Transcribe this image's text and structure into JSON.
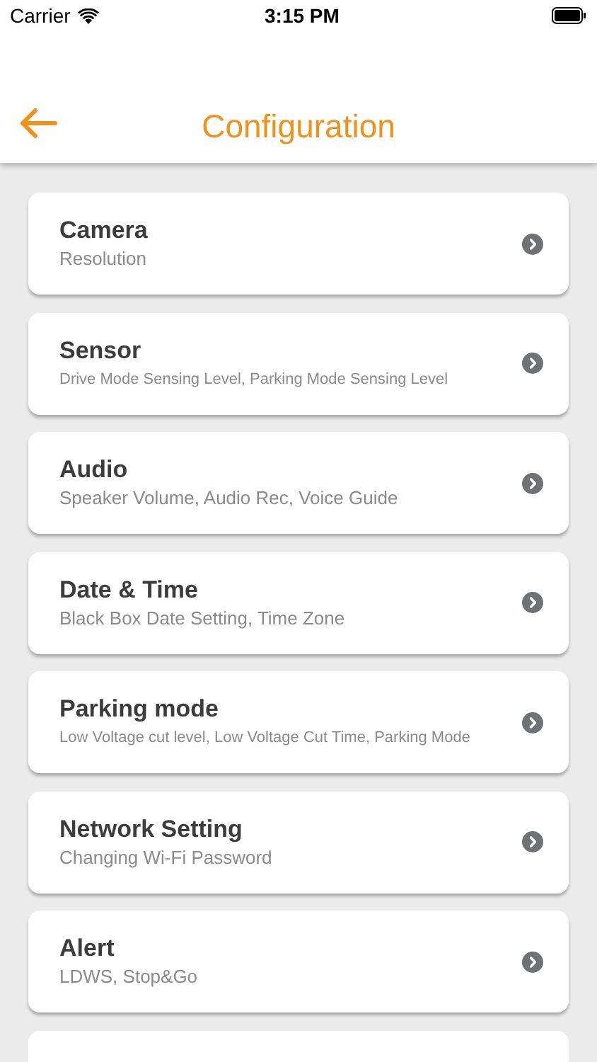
{
  "status_bar": {
    "carrier": "Carrier",
    "time": "3:15 PM"
  },
  "header": {
    "title": "Configuration"
  },
  "items": [
    {
      "title": "Camera",
      "subtitle": "Resolution"
    },
    {
      "title": "Sensor",
      "subtitle": "Drive Mode Sensing Level, Parking Mode Sensing Level"
    },
    {
      "title": "Audio",
      "subtitle": "Speaker Volume, Audio Rec, Voice Guide"
    },
    {
      "title": "Date & Time",
      "subtitle": "Black Box Date Setting, Time Zone"
    },
    {
      "title": "Parking mode",
      "subtitle": "Low Voltage cut level, Low Voltage Cut Time, Parking Mode"
    },
    {
      "title": "Network Setting",
      "subtitle": "Changing Wi-Fi Password"
    },
    {
      "title": "Alert",
      "subtitle": "LDWS, Stop&Go"
    }
  ]
}
